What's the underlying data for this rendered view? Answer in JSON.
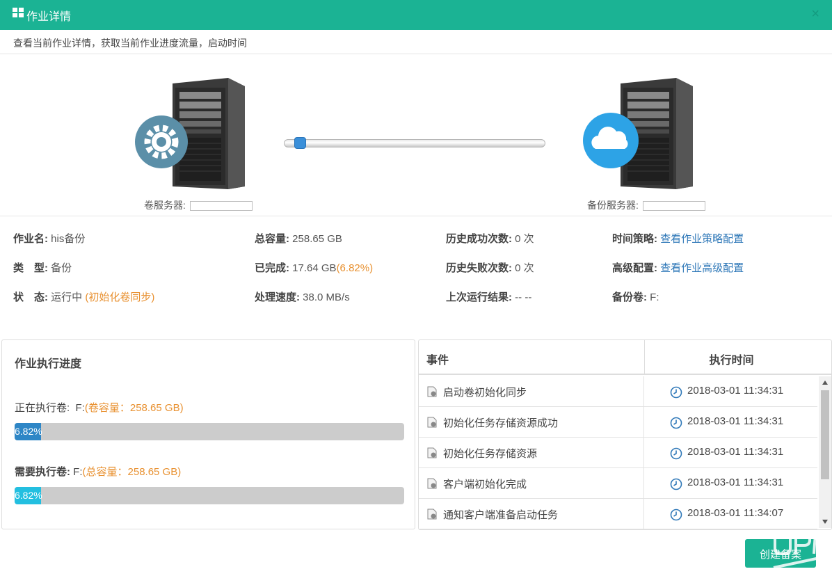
{
  "window": {
    "title": "作业详情",
    "close_glyph": "×"
  },
  "subtitle": "查看当前作业详情，获取当前作业进度流量，启动时间",
  "topology": {
    "source": {
      "label": "卷服务器:",
      "icon": "gear-icon",
      "badge_color": "#5b8fa8"
    },
    "target": {
      "label": "备份服务器:",
      "icon": "cloud-icon",
      "badge_color": "#2da3e6"
    },
    "transfer_progress": 0.0682
  },
  "info": {
    "job_name": {
      "label": "作业名:",
      "value": "his备份"
    },
    "type": {
      "label": "类　型:",
      "value": "备份"
    },
    "status": {
      "label": "状　态:",
      "value": "运行中",
      "detail": "(初始化卷同步)"
    },
    "total_capacity": {
      "label": "总容量:",
      "value": "258.65 GB"
    },
    "completed": {
      "label": "已完成:",
      "value": "17.64 GB",
      "percent": "(6.82%)"
    },
    "speed": {
      "label": "处理速度:",
      "value": "38.0 MB/s"
    },
    "history_success": {
      "label": "历史成功次数:",
      "value": "0 次"
    },
    "history_fail": {
      "label": "历史失败次数:",
      "value": "0 次"
    },
    "last_result": {
      "label": "上次运行结果:",
      "value": "-- --"
    },
    "time_policy": {
      "label": "时间策略:",
      "link": "查看作业策略配置"
    },
    "advanced": {
      "label": "高级配置:",
      "link": "查看作业高级配置"
    },
    "backup_volume": {
      "label": "备份卷:",
      "value": "F:"
    }
  },
  "progress": {
    "title": "作业执行进度",
    "current": {
      "label": "正在执行卷:",
      "volume": "F:",
      "detail": "(卷容量：258.65 GB)",
      "percent_text": "6.82%",
      "fraction": 0.0682
    },
    "required": {
      "label": "需要执行卷:",
      "volume": "F:",
      "detail": "(总容量：258.65 GB)",
      "percent_text": "6.82%",
      "fraction": 0.0682
    }
  },
  "events": {
    "col_event": "事件",
    "col_time": "执行时间",
    "rows": [
      {
        "text": "启动卷初始化同步",
        "time": "2018-03-01 11:34:31"
      },
      {
        "text": "初始化任务存储资源成功",
        "time": "2018-03-01 11:34:31"
      },
      {
        "text": "初始化任务存储资源",
        "time": "2018-03-01 11:34:31"
      },
      {
        "text": "客户端初始化完成",
        "time": "2018-03-01 11:34:31"
      },
      {
        "text": "通知客户端准备启动任务",
        "time": "2018-03-01 11:34:07"
      }
    ]
  },
  "footer": {
    "button_label": "创建备案"
  },
  "colors": {
    "accent": "#1bb394",
    "orange": "#e8902f",
    "link": "#2f78b8"
  }
}
